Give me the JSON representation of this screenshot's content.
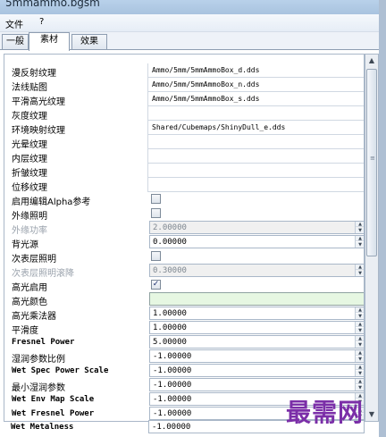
{
  "window": {
    "title": "5mmammo.bgsm"
  },
  "menu": [
    {
      "label": "文件"
    },
    {
      "label": "?"
    }
  ],
  "tabs": [
    {
      "label": "一般"
    },
    {
      "label": "素材"
    },
    {
      "label": "效果"
    }
  ],
  "active_tab_index": 1,
  "textures": [
    {
      "label": "漫反射纹理",
      "value": "Ammo/5mm/5mmAmmoBox_d.dds"
    },
    {
      "label": "法线贴图",
      "value": "Ammo/5mm/5mmAmmoBox_n.dds"
    },
    {
      "label": "平滑高光纹理",
      "value": "Ammo/5mm/5mmAmmoBox_s.dds"
    },
    {
      "label": "灰度纹理",
      "value": ""
    },
    {
      "label": "环境映射纹理",
      "value": "Shared/Cubemaps/ShinyDull_e.dds"
    },
    {
      "label": "光晕纹理",
      "value": ""
    },
    {
      "label": "内层纹理",
      "value": ""
    },
    {
      "label": "折皱纹理",
      "value": ""
    },
    {
      "label": "位移纹理",
      "value": ""
    }
  ],
  "properties": {
    "enable_editor_alpha_ref": {
      "label": "启用编辑Alpha参考",
      "checked": false
    },
    "rim_lighting": {
      "label": "外缘照明",
      "checked": false
    },
    "rim_power": {
      "label": "外缘功率",
      "value": "2.00000",
      "disabled": true
    },
    "back_light_power": {
      "label": "背光源",
      "value": "0.00000"
    },
    "subsurface_lighting": {
      "label": "次表层照明",
      "checked": false
    },
    "subsurface_rolloff": {
      "label": "次表层照明滚降",
      "value": "0.30000",
      "disabled": true
    },
    "specular_enabled": {
      "label": "高光启用",
      "checked": true
    },
    "specular_color": {
      "label": "高光颜色",
      "color": "#e6f7e2"
    },
    "specular_multiplier": {
      "label": "高光乘法器",
      "value": "1.00000"
    },
    "smoothness": {
      "label": "平滑度",
      "value": "1.00000"
    },
    "fresnel_power": {
      "label": "Fresnel Power",
      "value": "5.00000"
    },
    "wetness_control_scale": {
      "label": "湿润参数比例",
      "value": "-1.00000"
    },
    "wet_spec_power_scale": {
      "label": "Wet Spec Power Scale",
      "value": "-1.00000"
    },
    "wet_min_var": {
      "label": "最小湿润参数",
      "value": "-1.00000"
    },
    "wet_env_map_scale": {
      "label": "Wet Env Map Scale",
      "value": "-1.00000"
    },
    "wet_fresnel_power": {
      "label": "Wet Fresnel Power",
      "value": "-1.00000"
    },
    "wet_metalness": {
      "label": "Wet Metalness",
      "value": "-1.00000"
    }
  },
  "watermark": "最需网",
  "icons": {
    "scroll_up": "chevron-up-icon",
    "scroll_down": "chevron-down-icon",
    "checkmark": "check-icon",
    "grip": "scroll-grip-icon"
  },
  "colors": {
    "title_bar": "#b9d1ea",
    "watermark": "#7b2fa8",
    "specular_color": "#e6f7e2"
  }
}
